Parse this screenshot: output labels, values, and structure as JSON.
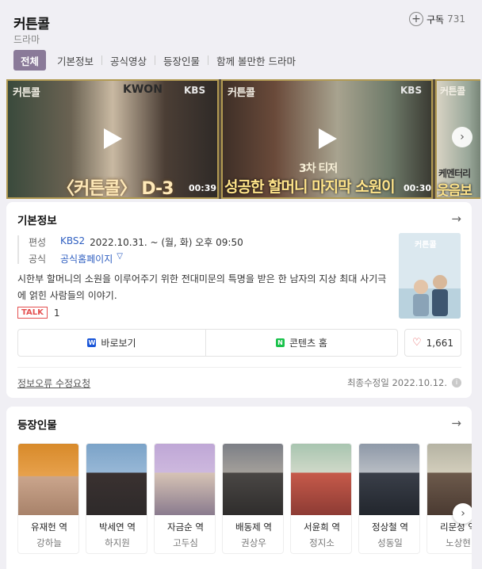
{
  "header": {
    "title": "커튼콜",
    "subtitle": "드라마",
    "subscribe_label": "구독",
    "subscribe_count": "731"
  },
  "tabs": [
    {
      "label": "전체",
      "active": true
    },
    {
      "label": "기본정보",
      "active": false
    },
    {
      "label": "공식영상",
      "active": false
    },
    {
      "label": "등장인물",
      "active": false
    },
    {
      "label": "함께 볼만한 드라마",
      "active": false
    }
  ],
  "videos": [
    {
      "logo": "커튼콜",
      "overlay": "KWON",
      "caption": "〈커튼콜〉 D-3",
      "badge": "KBS",
      "duration": "00:39"
    },
    {
      "logo": "커튼콜",
      "badge": "KBS",
      "caption_top": "3차 티저",
      "caption": "성공한 할머니 마지막 소원이",
      "duration": "00:30"
    },
    {
      "logo": "커튼콜",
      "caption_top": "케멘터리",
      "caption": "웃음보"
    }
  ],
  "basic_info": {
    "title": "기본정보",
    "rows": [
      {
        "key": "편성",
        "network": "KBS2",
        "value": "2022.10.31. ~ (월, 화) 오후 09:50"
      },
      {
        "key": "공식",
        "link": "공식홈페이지"
      }
    ],
    "description": "시한부 할머니의 소원을 이루어주기 위한 전대미문의 특명을 받은 한 남자의 지상 최대 사기극에 얽힌 사람들의 이야기.",
    "talk_badge": "TALK",
    "talk_count": "1",
    "poster_title": "커튼콜",
    "buttons": {
      "watch": "바로보기",
      "content_home": "콘텐츠 홈",
      "like_count": "1,661"
    },
    "report_link": "정보오류 수정요청",
    "updated": "최종수정일 2022.10.12."
  },
  "cast": {
    "title": "등장인물",
    "people": [
      {
        "role": "유재헌 역",
        "actor": "강하늘"
      },
      {
        "role": "박세연 역",
        "actor": "하지원"
      },
      {
        "role": "자금순 역",
        "actor": "고두심"
      },
      {
        "role": "배동제 역",
        "actor": "권상우"
      },
      {
        "role": "서윤희 역",
        "actor": "정지소"
      },
      {
        "role": "정상철 역",
        "actor": "성동일"
      },
      {
        "role": "리문성 역",
        "actor": "노상현"
      }
    ]
  },
  "colors": {
    "accent": "#8a7a99",
    "link": "#2f5fc1",
    "talk": "#e45050",
    "video_border": "#b29a52"
  },
  "icons": {
    "subscribe": "plus-circle-icon",
    "arrow": "arrow-right-icon",
    "next": "chevron-right-icon",
    "play": "play-icon",
    "like": "heart-icon",
    "info": "info-icon",
    "dropdown": "chevron-down-icon"
  }
}
